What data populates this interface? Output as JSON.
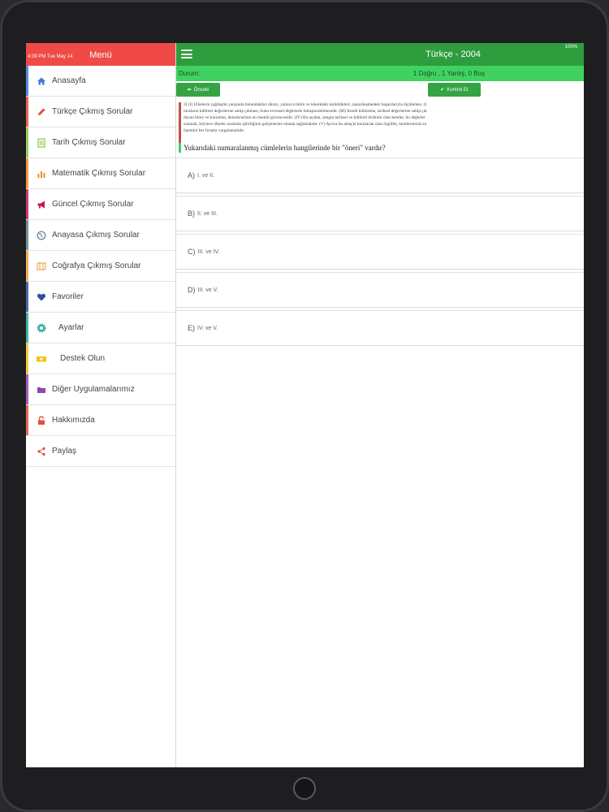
{
  "status_bar": {
    "time": "4:39 PM   Tue May 14",
    "battery": "100%"
  },
  "sidebar": {
    "title": "Menü",
    "items": [
      {
        "label": "Anasayfa",
        "icon": "home-icon",
        "color": "#3a7bd5"
      },
      {
        "label": "Türkçe Çıkmış Sorular",
        "icon": "pencil-icon",
        "color": "#e04a3f"
      },
      {
        "label": "Tarih Çıkmış Sorular",
        "icon": "notepad-icon",
        "color": "#8bc34a"
      },
      {
        "label": "Matematik Çıkmış Sorular",
        "icon": "bar-chart-icon",
        "color": "#f08a24"
      },
      {
        "label": "Güncel Çıkmış Sorular",
        "icon": "megaphone-icon",
        "color": "#c2185b"
      },
      {
        "label": "Anayasa Çıkmış Sorular",
        "icon": "globe-icon",
        "color": "#607d8b"
      },
      {
        "label": "Coğrafya Çıkmış Sorular",
        "icon": "map-icon",
        "color": "#f0a040"
      },
      {
        "label": "Favoriler",
        "icon": "heart-icon",
        "color": "#2f4fa0"
      },
      {
        "label": "Ayarlar",
        "icon": "gear-icon",
        "color": "#1fa89a"
      },
      {
        "label": "Destek Olun",
        "icon": "money-icon",
        "color": "#f0c419"
      },
      {
        "label": "Diğer Uygulamalarımız",
        "icon": "folder-icon",
        "color": "#8e44ad"
      },
      {
        "label": "Hakkımızda",
        "icon": "lock-icon",
        "color": "#e74c3c"
      },
      {
        "label": "Paylaş",
        "icon": "share-icon",
        "color": "#e74c3c"
      }
    ]
  },
  "header": {
    "title": "Türkçe - 2004"
  },
  "status": {
    "label": "Durum:",
    "value": "1 Doğru , 1 Yanlış, 0 Boş"
  },
  "buttons": {
    "prev": "Önceki",
    "check": "Kontrol Et"
  },
  "question": {
    "lines": [
      "3) (I) Ülkelerin çağdaşlık yarışında bulundukları düzey, yalnızca bilim ve teknikteki üstünlükleri, sanayileşmedeki başarılarıyla ölçülemez. (I",
      "ulusların kültürel değerlerine sahip çıkması, bunu evrensel değerlerle buluşturabilmesidir. (III) Kendi kültürüne, tarihsel değerlerine sahip çık",
      "duyan birey ve kurumlar, demokrasinin en önemli güvencesidir. (IV) Bu açıdan, zengin tarihsel ve kültürel birikimi olan kentler, bu değerler",
      "sunmalı, böylece ülkeler arasında işbirliğinin gelişmesine olanak sağlamalıdır. (V) Ayrıca bu amaçla kurulacak olan örgütler, kentlerimizin ta",
      "önemini her fırsatta vurgulamalıdır."
    ],
    "prompt": "Yukarıdaki numaralanmış cümlelerin hangilerinde bir \"öneri\" vardır?"
  },
  "options": [
    {
      "letter": "A)",
      "text": "I. ve II."
    },
    {
      "letter": "B)",
      "text": "II. ve III."
    },
    {
      "letter": "C)",
      "text": "III. ve IV."
    },
    {
      "letter": "D)",
      "text": "III. ve V."
    },
    {
      "letter": "E)",
      "text": "IV. ve V."
    }
  ]
}
